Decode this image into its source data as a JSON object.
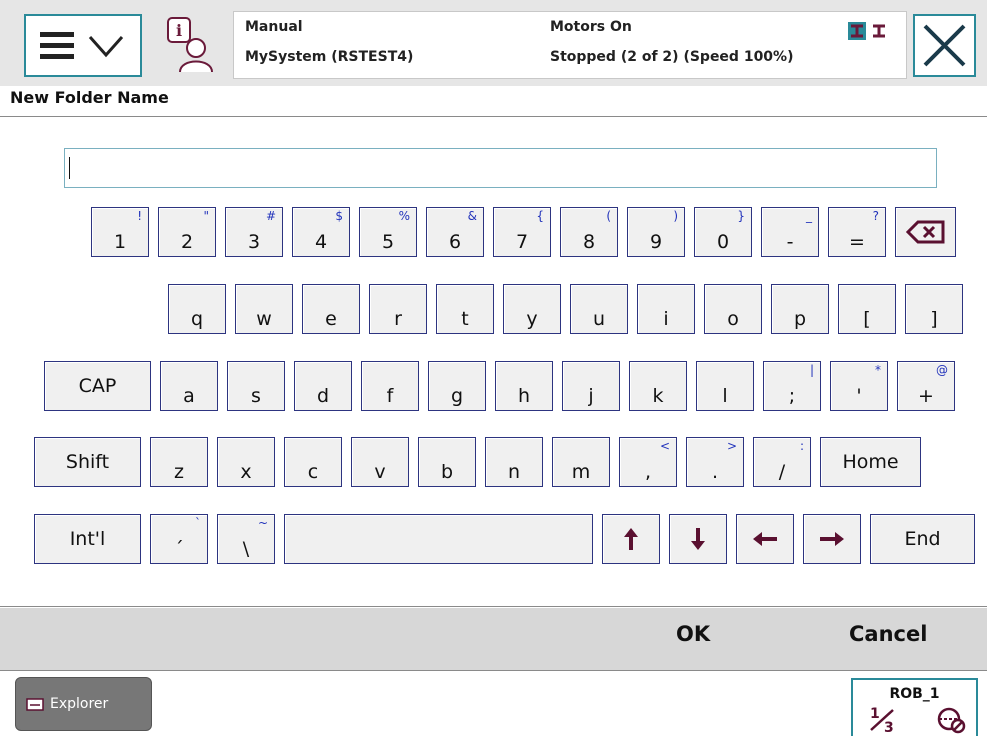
{
  "header": {
    "mode": "Manual",
    "system": "MySystem (RSTEST4)",
    "motors": "Motors On",
    "state": "Stopped (2 of 2) (Speed 100%)"
  },
  "window_title": "New Folder Name",
  "input": {
    "value": "",
    "placeholder": ""
  },
  "keyboard": {
    "row1": [
      {
        "main": "1",
        "shift": "!"
      },
      {
        "main": "2",
        "shift": "\""
      },
      {
        "main": "3",
        "shift": "#"
      },
      {
        "main": "4",
        "shift": "$"
      },
      {
        "main": "5",
        "shift": "%"
      },
      {
        "main": "6",
        "shift": "&"
      },
      {
        "main": "7",
        "shift": "{"
      },
      {
        "main": "8",
        "shift": "("
      },
      {
        "main": "9",
        "shift": ")"
      },
      {
        "main": "0",
        "shift": "}"
      },
      {
        "main": "-",
        "shift": "_"
      },
      {
        "main": "=",
        "shift": "?"
      }
    ],
    "row2": [
      "q",
      "w",
      "e",
      "r",
      "t",
      "y",
      "u",
      "i",
      "o",
      "p",
      "[",
      "]"
    ],
    "row3_label": "CAP",
    "row3": [
      {
        "main": "a",
        "shift": ""
      },
      {
        "main": "s",
        "shift": ""
      },
      {
        "main": "d",
        "shift": ""
      },
      {
        "main": "f",
        "shift": ""
      },
      {
        "main": "g",
        "shift": ""
      },
      {
        "main": "h",
        "shift": ""
      },
      {
        "main": "j",
        "shift": ""
      },
      {
        "main": "k",
        "shift": ""
      },
      {
        "main": "l",
        "shift": ""
      },
      {
        "main": ";",
        "shift": "|"
      },
      {
        "main": "'",
        "shift": "*"
      },
      {
        "main": "+",
        "shift": "@"
      }
    ],
    "row4_label": "Shift",
    "row4": [
      {
        "main": "z",
        "shift": ""
      },
      {
        "main": "x",
        "shift": ""
      },
      {
        "main": "c",
        "shift": ""
      },
      {
        "main": "v",
        "shift": ""
      },
      {
        "main": "b",
        "shift": ""
      },
      {
        "main": "n",
        "shift": ""
      },
      {
        "main": "m",
        "shift": ""
      },
      {
        "main": ",",
        "shift": "<"
      },
      {
        "main": ".",
        "shift": ">"
      },
      {
        "main": "/",
        "shift": ":"
      }
    ],
    "home": "Home",
    "intl": "Int'l",
    "row5_keys": [
      {
        "main": "´",
        "shift": "`"
      },
      {
        "main": "\\",
        "shift": "~"
      }
    ],
    "end": "End"
  },
  "actions": {
    "ok": "OK",
    "cancel": "Cancel"
  },
  "bottom": {
    "explorer": "Explorer",
    "robot": "ROB_1",
    "speed_fraction": "1/3"
  },
  "colors": {
    "accent": "#2a8a99",
    "key_border": "#2d3480",
    "arrow": "#5a1030",
    "shift_char": "#2233bb"
  }
}
